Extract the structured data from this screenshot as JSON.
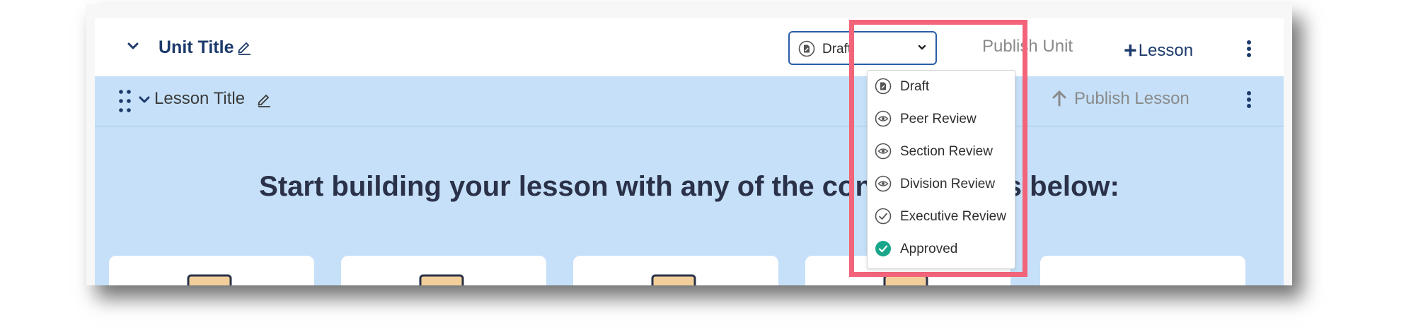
{
  "unit": {
    "title": "Unit Title",
    "publish_label": "Publish Unit",
    "add_lesson_label": "Lesson",
    "add_lesson_symbol": "+"
  },
  "status_select": {
    "value": "Draft",
    "options": [
      {
        "label": "Draft",
        "icon": "draft-doc-icon"
      },
      {
        "label": "Peer Review",
        "icon": "eye-icon"
      },
      {
        "label": "Section Review",
        "icon": "eye-icon"
      },
      {
        "label": "Division Review",
        "icon": "eye-icon"
      },
      {
        "label": "Executive Review",
        "icon": "check-circle-icon"
      },
      {
        "label": "Approved",
        "icon": "approved-check-icon"
      }
    ]
  },
  "lesson": {
    "title": "Lesson Title",
    "publish_label": "Publish Lesson"
  },
  "prompt": "Start building your lesson with any of the content blocks below:",
  "colors": {
    "accent": "#1c3a6b",
    "lesson_bg": "#c5e0f8",
    "highlight": "#f2647a",
    "approved": "#19a68a"
  }
}
